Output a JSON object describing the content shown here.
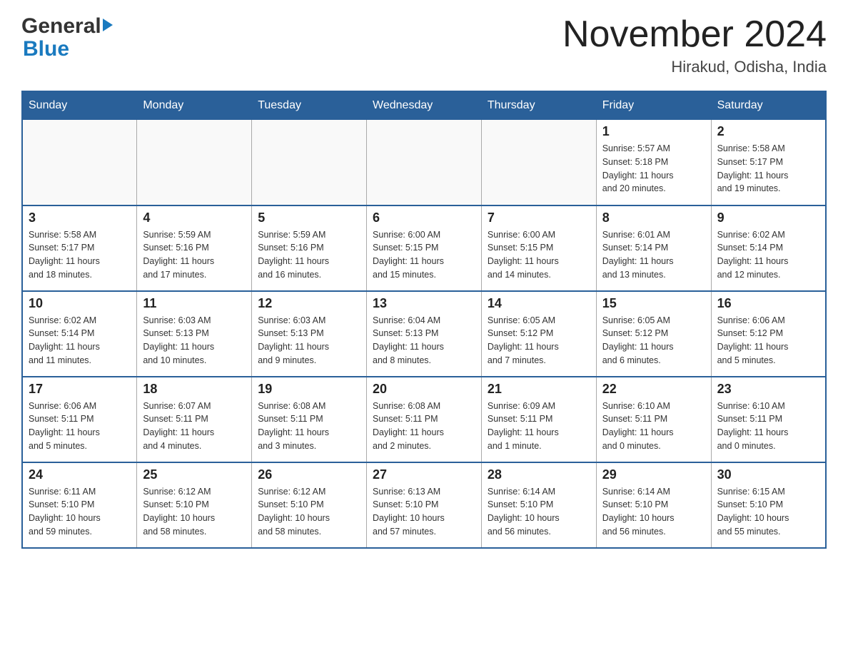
{
  "header": {
    "logo": {
      "line1": "General",
      "line2": "Blue"
    },
    "title": "November 2024",
    "location": "Hirakud, Odisha, India"
  },
  "weekdays": [
    "Sunday",
    "Monday",
    "Tuesday",
    "Wednesday",
    "Thursday",
    "Friday",
    "Saturday"
  ],
  "weeks": [
    [
      {
        "day": "",
        "info": ""
      },
      {
        "day": "",
        "info": ""
      },
      {
        "day": "",
        "info": ""
      },
      {
        "day": "",
        "info": ""
      },
      {
        "day": "",
        "info": ""
      },
      {
        "day": "1",
        "info": "Sunrise: 5:57 AM\nSunset: 5:18 PM\nDaylight: 11 hours\nand 20 minutes."
      },
      {
        "day": "2",
        "info": "Sunrise: 5:58 AM\nSunset: 5:17 PM\nDaylight: 11 hours\nand 19 minutes."
      }
    ],
    [
      {
        "day": "3",
        "info": "Sunrise: 5:58 AM\nSunset: 5:17 PM\nDaylight: 11 hours\nand 18 minutes."
      },
      {
        "day": "4",
        "info": "Sunrise: 5:59 AM\nSunset: 5:16 PM\nDaylight: 11 hours\nand 17 minutes."
      },
      {
        "day": "5",
        "info": "Sunrise: 5:59 AM\nSunset: 5:16 PM\nDaylight: 11 hours\nand 16 minutes."
      },
      {
        "day": "6",
        "info": "Sunrise: 6:00 AM\nSunset: 5:15 PM\nDaylight: 11 hours\nand 15 minutes."
      },
      {
        "day": "7",
        "info": "Sunrise: 6:00 AM\nSunset: 5:15 PM\nDaylight: 11 hours\nand 14 minutes."
      },
      {
        "day": "8",
        "info": "Sunrise: 6:01 AM\nSunset: 5:14 PM\nDaylight: 11 hours\nand 13 minutes."
      },
      {
        "day": "9",
        "info": "Sunrise: 6:02 AM\nSunset: 5:14 PM\nDaylight: 11 hours\nand 12 minutes."
      }
    ],
    [
      {
        "day": "10",
        "info": "Sunrise: 6:02 AM\nSunset: 5:14 PM\nDaylight: 11 hours\nand 11 minutes."
      },
      {
        "day": "11",
        "info": "Sunrise: 6:03 AM\nSunset: 5:13 PM\nDaylight: 11 hours\nand 10 minutes."
      },
      {
        "day": "12",
        "info": "Sunrise: 6:03 AM\nSunset: 5:13 PM\nDaylight: 11 hours\nand 9 minutes."
      },
      {
        "day": "13",
        "info": "Sunrise: 6:04 AM\nSunset: 5:13 PM\nDaylight: 11 hours\nand 8 minutes."
      },
      {
        "day": "14",
        "info": "Sunrise: 6:05 AM\nSunset: 5:12 PM\nDaylight: 11 hours\nand 7 minutes."
      },
      {
        "day": "15",
        "info": "Sunrise: 6:05 AM\nSunset: 5:12 PM\nDaylight: 11 hours\nand 6 minutes."
      },
      {
        "day": "16",
        "info": "Sunrise: 6:06 AM\nSunset: 5:12 PM\nDaylight: 11 hours\nand 5 minutes."
      }
    ],
    [
      {
        "day": "17",
        "info": "Sunrise: 6:06 AM\nSunset: 5:11 PM\nDaylight: 11 hours\nand 5 minutes."
      },
      {
        "day": "18",
        "info": "Sunrise: 6:07 AM\nSunset: 5:11 PM\nDaylight: 11 hours\nand 4 minutes."
      },
      {
        "day": "19",
        "info": "Sunrise: 6:08 AM\nSunset: 5:11 PM\nDaylight: 11 hours\nand 3 minutes."
      },
      {
        "day": "20",
        "info": "Sunrise: 6:08 AM\nSunset: 5:11 PM\nDaylight: 11 hours\nand 2 minutes."
      },
      {
        "day": "21",
        "info": "Sunrise: 6:09 AM\nSunset: 5:11 PM\nDaylight: 11 hours\nand 1 minute."
      },
      {
        "day": "22",
        "info": "Sunrise: 6:10 AM\nSunset: 5:11 PM\nDaylight: 11 hours\nand 0 minutes."
      },
      {
        "day": "23",
        "info": "Sunrise: 6:10 AM\nSunset: 5:11 PM\nDaylight: 11 hours\nand 0 minutes."
      }
    ],
    [
      {
        "day": "24",
        "info": "Sunrise: 6:11 AM\nSunset: 5:10 PM\nDaylight: 10 hours\nand 59 minutes."
      },
      {
        "day": "25",
        "info": "Sunrise: 6:12 AM\nSunset: 5:10 PM\nDaylight: 10 hours\nand 58 minutes."
      },
      {
        "day": "26",
        "info": "Sunrise: 6:12 AM\nSunset: 5:10 PM\nDaylight: 10 hours\nand 58 minutes."
      },
      {
        "day": "27",
        "info": "Sunrise: 6:13 AM\nSunset: 5:10 PM\nDaylight: 10 hours\nand 57 minutes."
      },
      {
        "day": "28",
        "info": "Sunrise: 6:14 AM\nSunset: 5:10 PM\nDaylight: 10 hours\nand 56 minutes."
      },
      {
        "day": "29",
        "info": "Sunrise: 6:14 AM\nSunset: 5:10 PM\nDaylight: 10 hours\nand 56 minutes."
      },
      {
        "day": "30",
        "info": "Sunrise: 6:15 AM\nSunset: 5:10 PM\nDaylight: 10 hours\nand 55 minutes."
      }
    ]
  ]
}
